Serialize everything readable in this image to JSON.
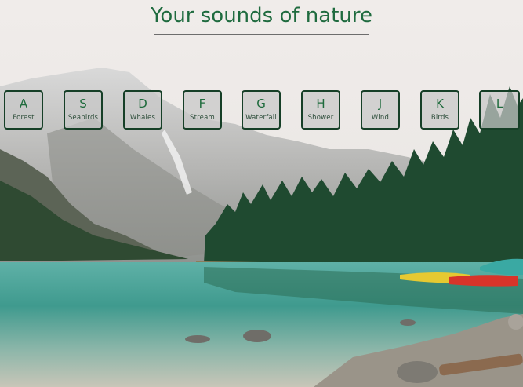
{
  "title": "Your sounds of nature",
  "keys": [
    {
      "letter": "A",
      "label": "Forest"
    },
    {
      "letter": "S",
      "label": "Seabirds"
    },
    {
      "letter": "D",
      "label": "Whales"
    },
    {
      "letter": "F",
      "label": "Stream"
    },
    {
      "letter": "G",
      "label": "Waterfall"
    },
    {
      "letter": "H",
      "label": "Shower"
    },
    {
      "letter": "J",
      "label": "Wind"
    },
    {
      "letter": "K",
      "label": "Birds"
    },
    {
      "letter": "L",
      "label": ""
    }
  ],
  "colors": {
    "title": "#1f6b3f",
    "key_border": "#163f27",
    "lake": "#3f9a8e",
    "forest": "#1f4a30"
  }
}
